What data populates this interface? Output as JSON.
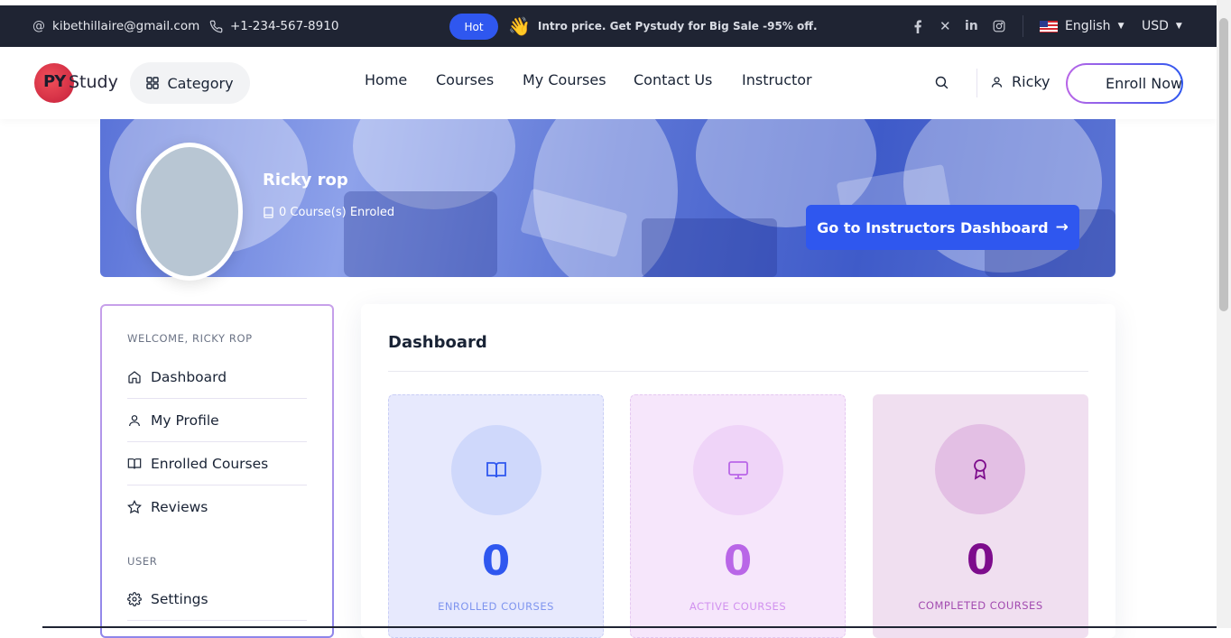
{
  "topbar": {
    "email": "kibethillaire@gmail.com",
    "phone": "+1-234-567-8910",
    "badge": "Hot",
    "promo": "Intro price. Get Pystudy for Big Sale -95% off.",
    "language": "English",
    "currency": "USD",
    "social_icons": [
      "facebook-icon",
      "x-icon",
      "linkedin-icon",
      "instagram-icon"
    ]
  },
  "header": {
    "logo_py": "PY",
    "logo_study": "Study",
    "category_label": "Category",
    "nav": [
      "Home",
      "Courses",
      "My Courses",
      "Contact Us",
      "Instructor"
    ],
    "user_name": "Ricky",
    "enroll_label": "Enroll Now"
  },
  "profile": {
    "name": "Ricky rop",
    "enrolled": "0 Course(s) Enroled",
    "dashboard_button": "Go to Instructors Dashboard"
  },
  "sidebar": {
    "welcome": "WELCOME, RICKY ROP",
    "items": [
      {
        "label": "Dashboard",
        "icon": "home-icon"
      },
      {
        "label": "My Profile",
        "icon": "user-icon"
      },
      {
        "label": "Enrolled Courses",
        "icon": "book-open-icon"
      },
      {
        "label": "Reviews",
        "icon": "star-icon"
      }
    ],
    "user_section": "USER",
    "settings": {
      "label": "Settings",
      "icon": "gear-icon"
    }
  },
  "dashboard": {
    "title": "Dashboard",
    "stats": [
      {
        "value": "0",
        "label": "ENROLLED COURSES",
        "icon": "book-open-icon",
        "color": "#2f57ef"
      },
      {
        "value": "0",
        "label": "ACTIVE COURSES",
        "icon": "monitor-icon",
        "color": "#b966e7"
      },
      {
        "value": "0",
        "label": "COMPLETED COURSES",
        "icon": "award-icon",
        "color": "#7d0c8c"
      }
    ]
  }
}
